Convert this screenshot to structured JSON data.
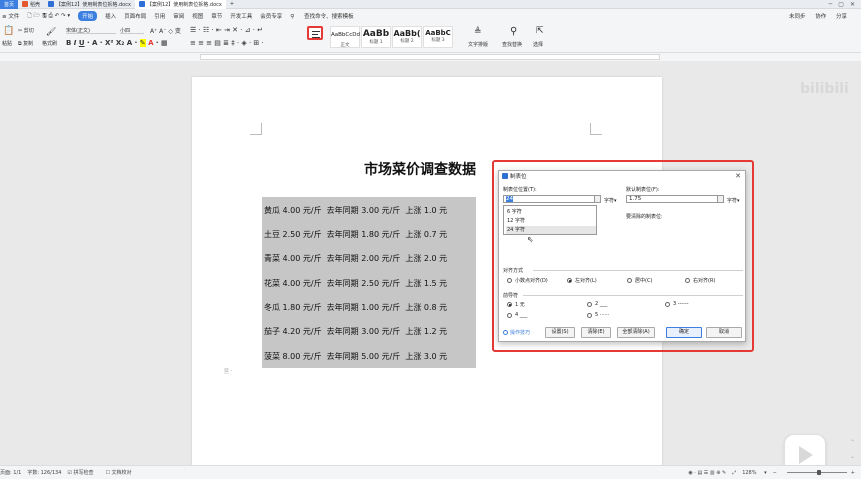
{
  "titlebar": {
    "home": "首页",
    "tab1": "稻壳",
    "tab2": "【案例12】使用制表位拆格.docx",
    "tab3": "【案例12】使用制表位拆格.docx",
    "new_tab": "+"
  },
  "menubar": {
    "file": "≡ 文件",
    "start": "开始",
    "insert": "插入",
    "layout": "页面布局",
    "reference": "引用",
    "review": "审阅",
    "view": "视图",
    "chapter": "章节",
    "dev": "开发工具",
    "member": "会员专享",
    "search": "查找命令、搜索模板",
    "sync": "未同步",
    "collab": "协作",
    "share": "分享"
  },
  "ribbon": {
    "paste": "粘贴",
    "cut": "剪切",
    "copy": "复制",
    "format_painter": "格式刷",
    "font": "宋体(正文)",
    "size": "小四",
    "styles": [
      {
        "preview": "AaBbCcDd",
        "name": "正文"
      },
      {
        "preview": "AaBb",
        "name": "标题 1"
      },
      {
        "preview": "AaBb(",
        "name": "标题 2"
      },
      {
        "preview": "AaBbC",
        "name": "标题 3"
      }
    ],
    "text_layout": "文字排版",
    "find_replace": "查找替换",
    "select": "选择"
  },
  "document": {
    "title": "市场菜价调查数据",
    "lines": [
      "黄瓜 4.00 元/斤  去年同期 3.00 元/斤  上涨 1.0 元",
      "土豆 2.50 元/斤  去年同期 1.80 元/斤  上涨 0.7 元",
      "青菜 4.00 元/斤  去年同期 2.00 元/斤  上涨 2.0 元",
      "花菜 4.00 元/斤  去年同期 2.50 元/斤  上涨 1.5 元",
      "冬瓜 1.80 元/斤  去年同期 1.00 元/斤  上涨 0.8 元",
      "茄子 4.20 元/斤  去年同期 3.00 元/斤  上涨 1.2 元",
      "菠菜 8.00 元/斤  去年同期 5.00 元/斤  上涨 3.0 元"
    ]
  },
  "dialog": {
    "title": "制表位",
    "tab_pos_label": "制表位位置(T):",
    "tab_pos_value": "24",
    "unit": "字符",
    "default_tab_label": "默认制表位(F):",
    "default_tab_value": "1.75",
    "clear_label": "要清除的制表位:",
    "tab_list": [
      "6 字符",
      "12 字符",
      "24 字符"
    ],
    "align_label": "对齐方式",
    "align": [
      "小数点对齐(D)",
      "左对齐(L)",
      "居中(C)",
      "右对齐(R)"
    ],
    "leader_label": "前导符",
    "leaders": [
      "1 无",
      "2 ___",
      "3 ------",
      "4 ___",
      "5 ······"
    ],
    "tips": "操作技巧",
    "btn_set": "设置(S)",
    "btn_clear": "清除(E)",
    "btn_clear_all": "全部清除(A)",
    "btn_ok": "确定",
    "btn_cancel": "取消"
  },
  "statusbar": {
    "page": "页面: 1/1",
    "words": "字数: 126/134",
    "spell": "拼写检查",
    "proof": "文档校对",
    "zoom": "128%"
  }
}
